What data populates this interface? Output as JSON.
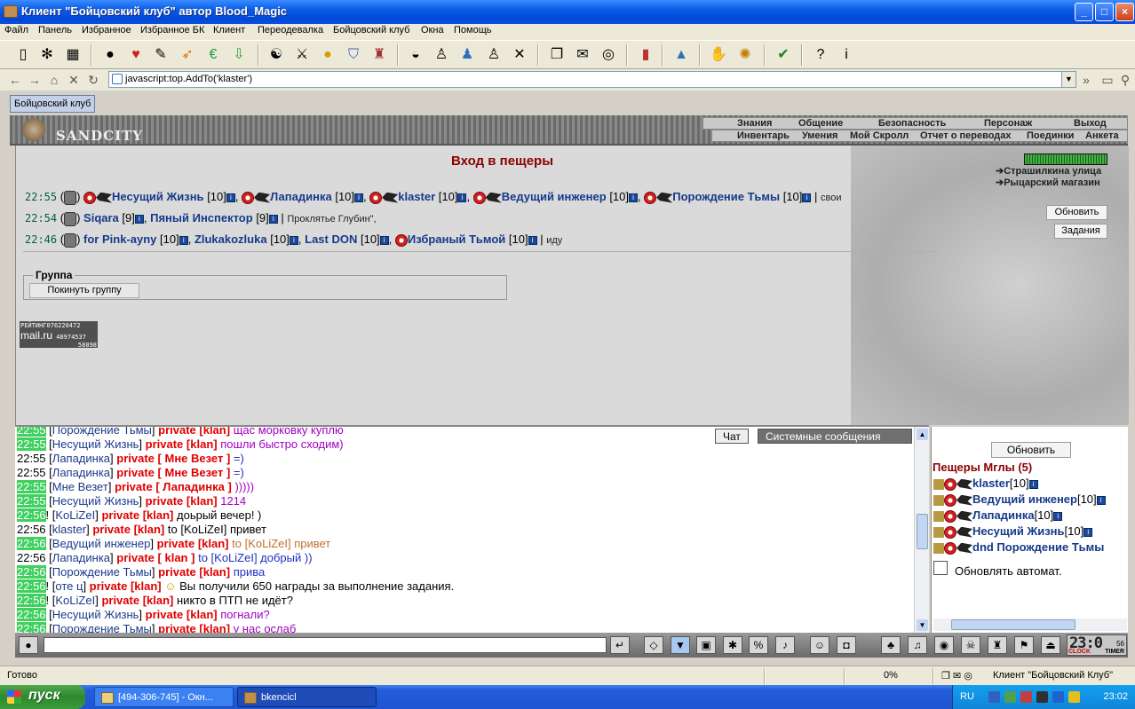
{
  "window": {
    "title": "Клиент \"Бойцовский клуб\" автор Blood_Magic",
    "minimize": "_",
    "maximize": "□",
    "close": "×"
  },
  "menu": [
    "Файл",
    "Панель",
    "Избранное",
    "Избранное БК",
    "Клиент",
    "Переодевалка",
    "Бойцовский клуб",
    "Окна",
    "Помощь"
  ],
  "address": {
    "url": "javascript:top.AddTo('klaster')"
  },
  "tabs": {
    "active": "Бойцовский клуб"
  },
  "game": {
    "logo": "SANDCITY",
    "nav_main": [
      "Знания",
      "Общение",
      "Безопасность",
      "Персонаж",
      "Выход"
    ],
    "nav_sub": [
      "Инвентарь",
      "Умения",
      "Мой Скролл",
      "Отчет о переводах",
      "Поединки",
      "Анкета"
    ],
    "room_title": "Вход в пещеры",
    "location_links": [
      "Страшилкина улица",
      "Рыцарский магазин"
    ],
    "refresh_btn": "Обновить",
    "tasks_btn": "Задания",
    "group_legend": "Группа",
    "leave_group_btn": "Покинуть группу",
    "rating": {
      "label": "РЕЙТИНГ",
      "v1": "076220472",
      "v2": "48974537",
      "v3": "58898",
      "brand": "mail.ru"
    },
    "hp_fraction": 1.0,
    "parties": [
      {
        "time": "22:55",
        "note": "свои",
        "players": [
          {
            "name": "Несущий Жизнь",
            "level": "[10]"
          },
          {
            "name": "Лападинка",
            "level": "[10]"
          },
          {
            "name": "klaster",
            "level": "[10]"
          },
          {
            "name": "Ведущий инженер",
            "level": "[10]"
          },
          {
            "name": "Порождение Тьмы",
            "level": "[10]"
          }
        ]
      },
      {
        "time": "22:54",
        "note": "Проклятье Глубин\",",
        "players": [
          {
            "name": "Siqara",
            "level": "[9]"
          },
          {
            "name": "Пяный Инспектор",
            "level": "[9]"
          }
        ]
      },
      {
        "time": "22:46",
        "note": "иду",
        "players": [
          {
            "name": "for Pink-ayny",
            "level": "[10]"
          },
          {
            "name": "Zlukakozluka",
            "level": "[10]"
          },
          {
            "name": "Last DON",
            "level": "[10]"
          },
          {
            "name": "Избраный Тьмой",
            "level": "[10]"
          }
        ]
      }
    ]
  },
  "chat": {
    "tab_chat": "Чат",
    "tab_system": "Системные сообщения",
    "private": "private",
    "lines": [
      {
        "time": "22:55",
        "hl": true,
        "nick": "Порождение Тьмы",
        "to": "[klan]",
        "text": "щас морковку куплю",
        "style": "msg-purple"
      },
      {
        "time": "22:55",
        "hl": true,
        "nick": "Несущий Жизнь",
        "to": "[klan]",
        "text": "пошли быстро сходим)",
        "style": "msg-purple"
      },
      {
        "time": "22:55",
        "hl": false,
        "nick": "Лападинка",
        "to": "[ Мне Везет ]",
        "text": "=)",
        "style": "msg-blue"
      },
      {
        "time": "22:55",
        "hl": false,
        "nick": "Лападинка",
        "to": "[ Мне Везет ]",
        "text": "=)",
        "style": "msg-blue"
      },
      {
        "time": "22:55",
        "hl": true,
        "nick": "Мне Везет",
        "to": "[ Лападинка ]",
        "text": ")))))",
        "style": "msg-purple"
      },
      {
        "time": "22:55",
        "hl": true,
        "nick": "Несущий Жизнь",
        "to": "[klan]",
        "text": "1214",
        "style": "msg-purple"
      },
      {
        "time": "22:56",
        "hl": true,
        "bang": true,
        "nick": "KoLiZeI",
        "to": "[klan]",
        "text": "доьрый вечер! )",
        "style": "msg-black"
      },
      {
        "time": "22:56",
        "hl": false,
        "nick": "klaster",
        "to": "[klan]",
        "text": "to [KoLiZeI] привет",
        "style": "msg-black"
      },
      {
        "time": "22:56",
        "hl": true,
        "nick": "Ведущий инженер",
        "to": "[klan]",
        "text": "to [KoLiZeI] привет",
        "style": "msg-orange"
      },
      {
        "time": "22:56",
        "hl": false,
        "nick": "Лападинка",
        "to": "[ klan ]",
        "text": "to [KoLiZeI] добрый ))",
        "style": "msg-blue"
      },
      {
        "time": "22:56",
        "hl": true,
        "nick": "Порождение Тьмы",
        "to": "[klan]",
        "text": "прива",
        "style": "msg-blue"
      },
      {
        "time": "22:56",
        "hl": true,
        "bang": true,
        "nick": "оте ц",
        "to": "[klan]",
        "text": "Вы получили 650 награды за выполнение задания.",
        "style": "msg-black",
        "smile": true
      },
      {
        "time": "22:56",
        "hl": true,
        "bang": true,
        "nick": "KoLiZeI",
        "to": "[klan]",
        "text": "никто в ПТП не идёт?",
        "style": "msg-black"
      },
      {
        "time": "22:56",
        "hl": true,
        "nick": "Несущий Жизнь",
        "to": "[klan]",
        "text": "погнали?",
        "style": "msg-purple"
      },
      {
        "time": "22:56",
        "hl": true,
        "nick": "Порождение Тьмы",
        "to": "[klan]",
        "text": "у нас ослаб",
        "style": "msg-purple"
      }
    ]
  },
  "online": {
    "refresh_btn": "Обновить",
    "room": "Пещеры Мглы (5)",
    "users": [
      {
        "name": "klaster",
        "level": "[10]"
      },
      {
        "name": "Ведущий инженер",
        "level": "[10]"
      },
      {
        "name": "Лападинка",
        "level": "[10]"
      },
      {
        "name": "Несущий Жизнь",
        "level": "[10]"
      },
      {
        "name": "dnd Порождение Тьмы",
        "level": ""
      }
    ],
    "auto_refresh_label": "Обновлять автомат."
  },
  "clock": {
    "time": "23:0",
    "sec": "56",
    "label_clock": "CLOCK",
    "label_timer": "TIMER"
  },
  "status": {
    "text": "Готово",
    "progress": "0%",
    "zone": "Клиент \"Бойцовский Клуб\""
  },
  "taskbar": {
    "start": "пуск",
    "tasks": [
      "[494-306-745] - Окн...",
      "bkencicl"
    ],
    "lang": "RU",
    "time": "23:02"
  }
}
